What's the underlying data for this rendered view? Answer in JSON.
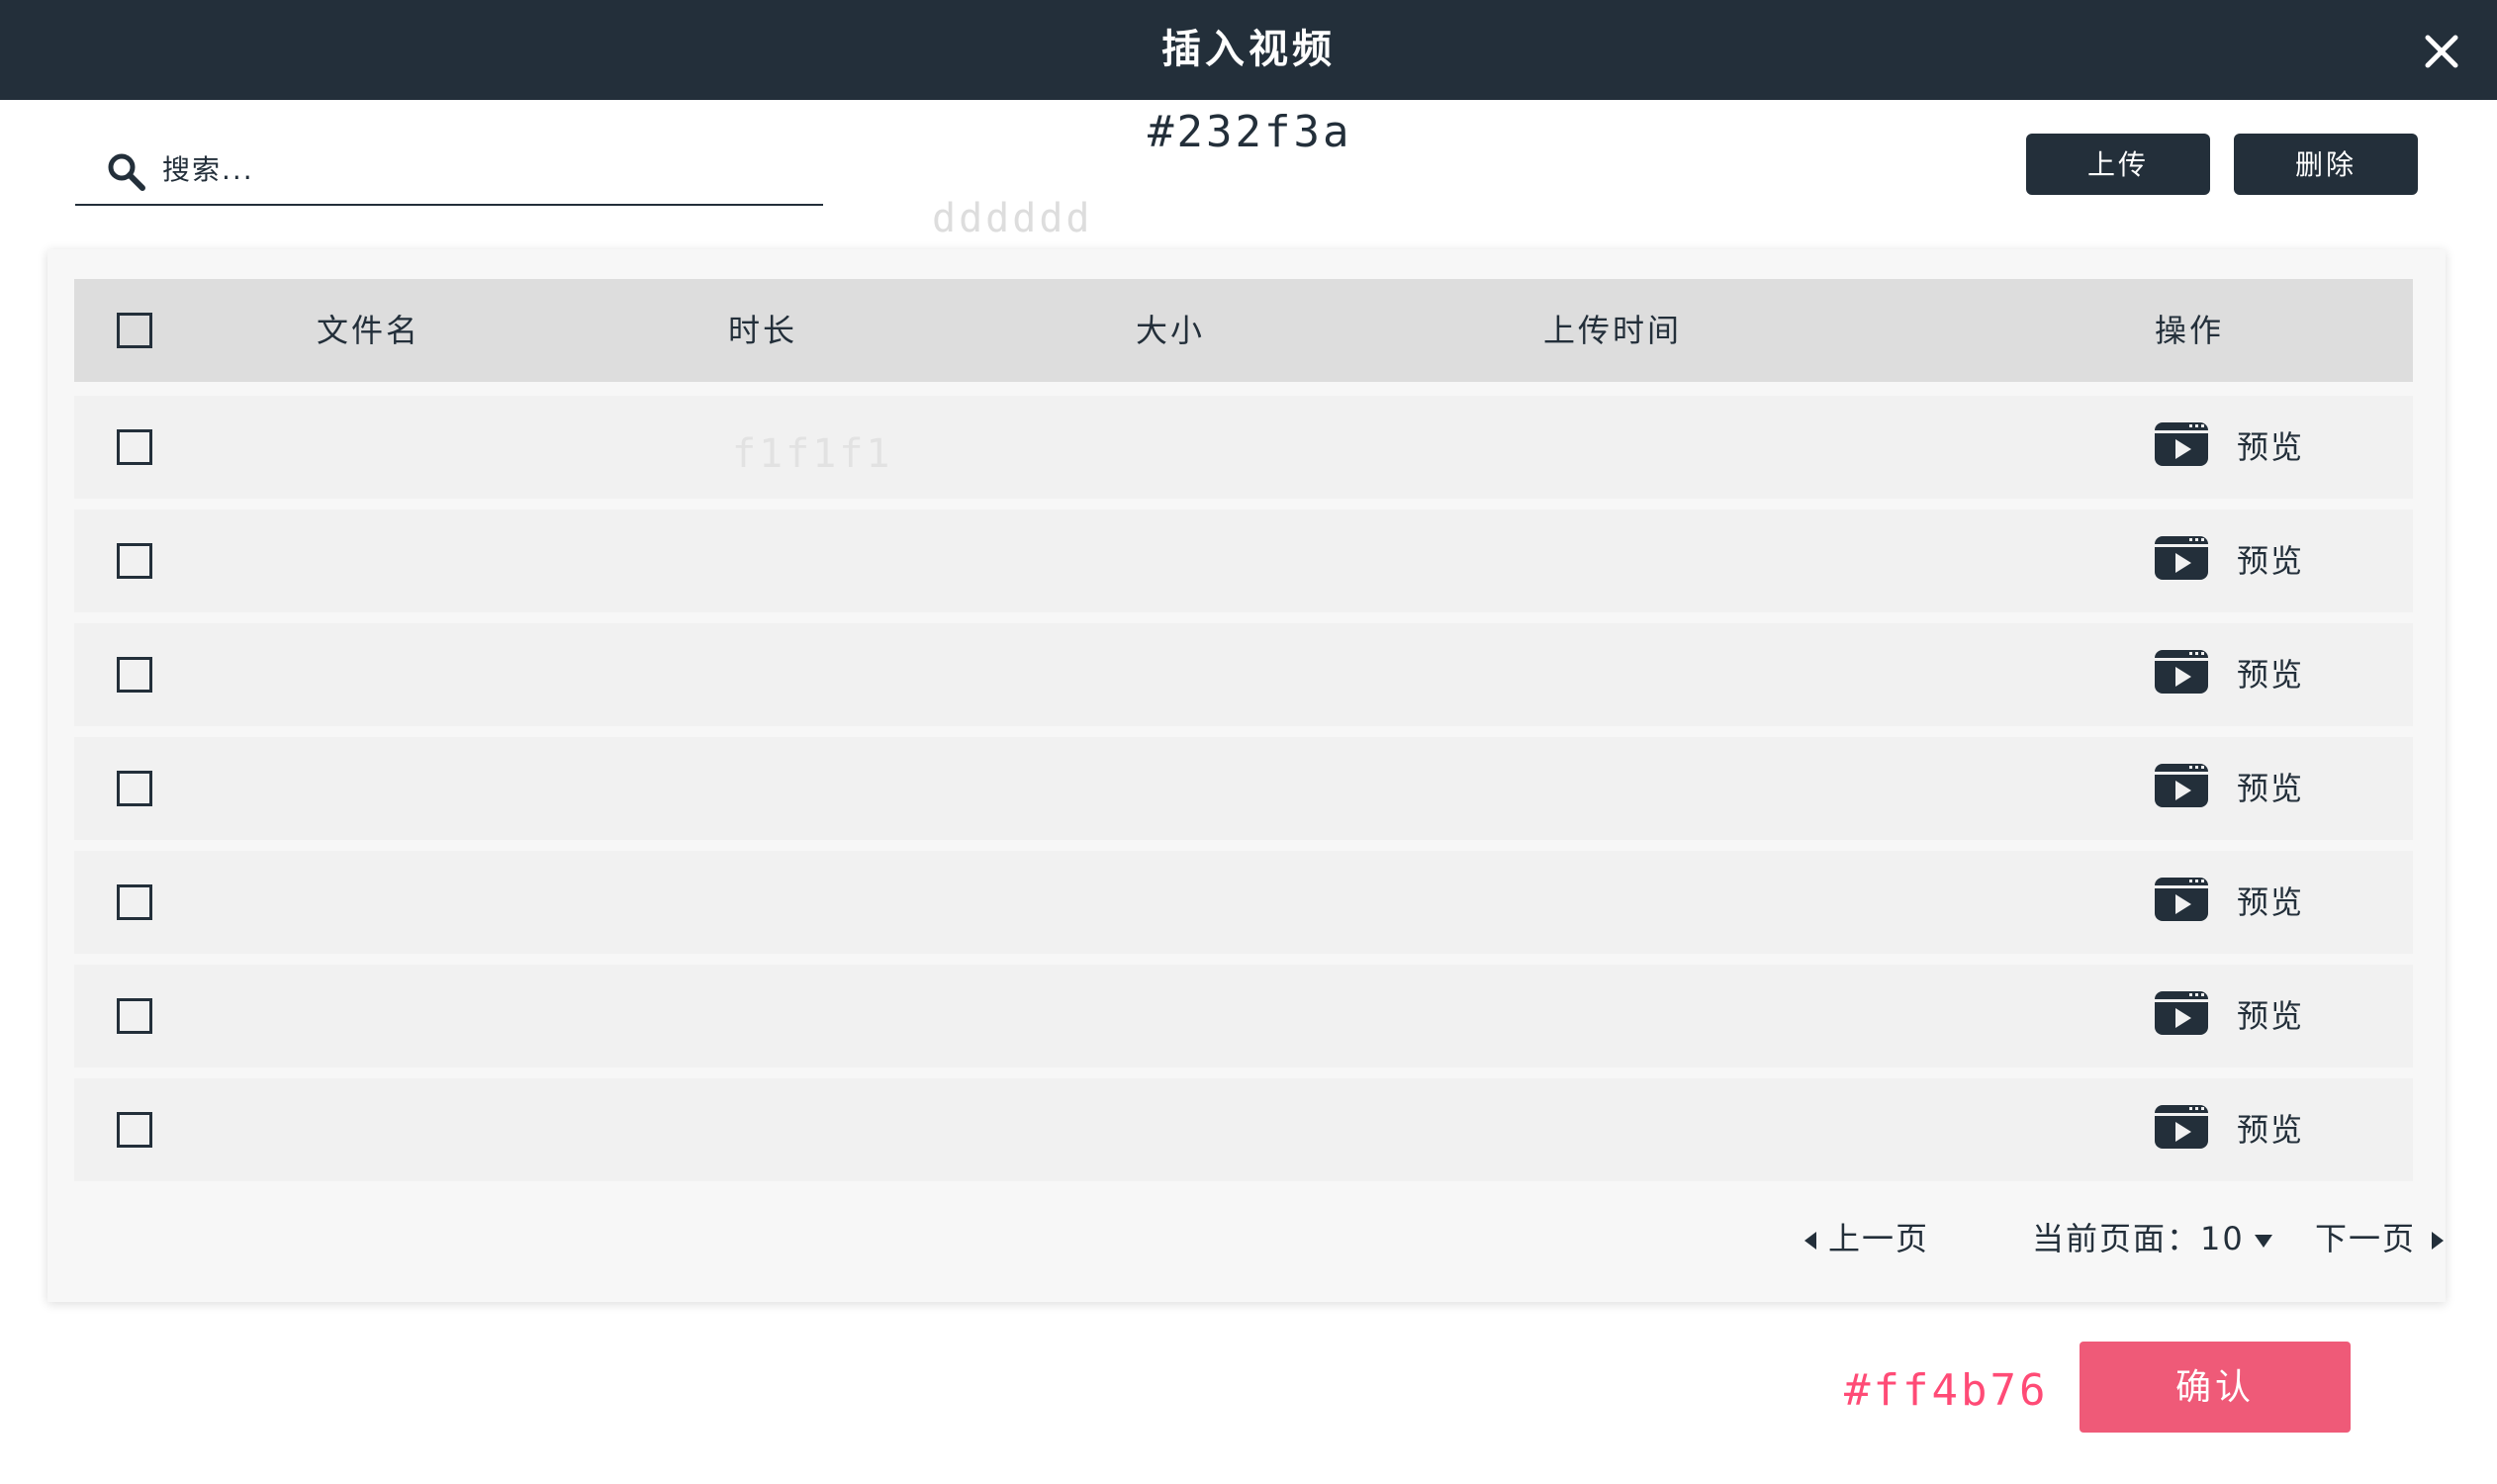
{
  "dialog": {
    "title": "插入视频",
    "close_icon": "close-icon"
  },
  "search": {
    "placeholder": "搜索...",
    "icon": "search-icon"
  },
  "toolbar": {
    "upload_label": "上传",
    "delete_label": "删除"
  },
  "annotations": {
    "header_color": "#232f3a",
    "border_color": "dddddd",
    "row_color": "f1f1f1",
    "accent_color": "#ff4b76"
  },
  "table": {
    "columns": [
      "文件名",
      "时长",
      "大小",
      "上传时间",
      "操作"
    ],
    "rows": [
      {
        "action_label": "预览"
      },
      {
        "action_label": "预览"
      },
      {
        "action_label": "预览"
      },
      {
        "action_label": "预览"
      },
      {
        "action_label": "预览"
      },
      {
        "action_label": "预览"
      },
      {
        "action_label": "预览"
      }
    ],
    "action_icon": "video-play-icon"
  },
  "pagination": {
    "prev_label": "上一页",
    "current_label": "当前页面：",
    "current_page": "10",
    "next_label": "下一页"
  },
  "footer": {
    "confirm_label": "确认"
  },
  "colors": {
    "header_bg": "#232f3a",
    "table_header_bg": "#dddddd",
    "row_bg": "#f1f1f1",
    "panel_bg": "#f7f7f7",
    "confirm_bg": "#ef5a78",
    "accent": "#ff4b76"
  }
}
